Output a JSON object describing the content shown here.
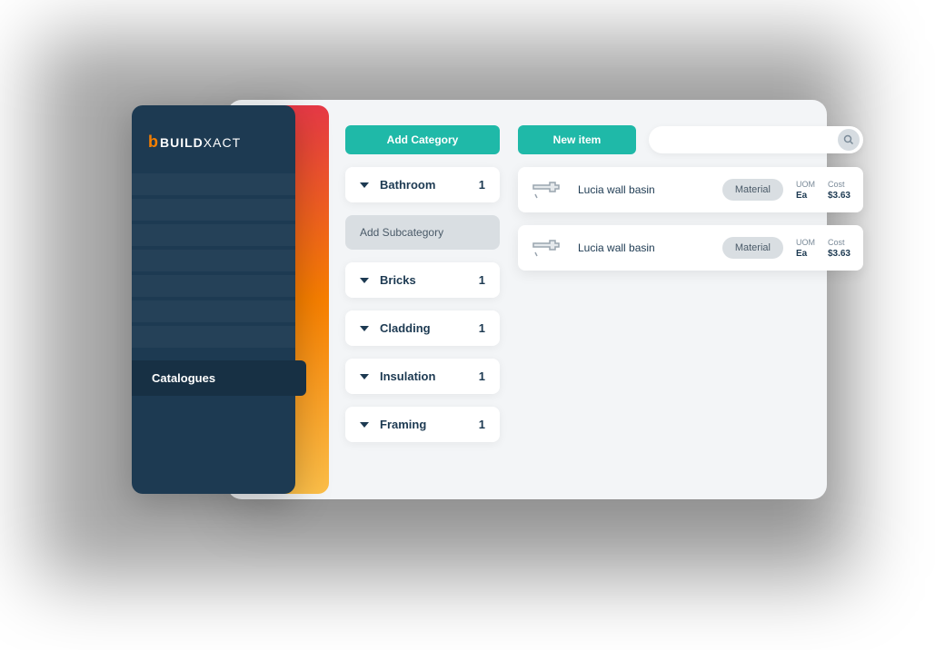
{
  "brand": {
    "icon_letter": "b",
    "name_bold": "BUILD",
    "name_light": "XACT"
  },
  "sidebar": {
    "active_label": "Catalogues"
  },
  "buttons": {
    "add_category": "Add Category",
    "new_item": "New item",
    "add_subcategory": "Add Subcategory"
  },
  "categories": [
    {
      "label": "Bathroom",
      "count": "1"
    },
    {
      "label": "Bricks",
      "count": "1"
    },
    {
      "label": "Cladding",
      "count": "1"
    },
    {
      "label": "Insulation",
      "count": "1"
    },
    {
      "label": "Framing",
      "count": "1"
    }
  ],
  "items": [
    {
      "name": "Lucia wall basin",
      "tag": "Material",
      "uom_label": "UOM",
      "uom_value": "Ea",
      "cost_label": "Cost",
      "cost_value": "$3.63"
    },
    {
      "name": "Lucia wall basin",
      "tag": "Material",
      "uom_label": "UOM",
      "uom_value": "Ea",
      "cost_label": "Cost",
      "cost_value": "$3.63"
    }
  ],
  "colors": {
    "teal": "#1fb9a8",
    "navy": "#1d3a52",
    "accent_top": "#e63946",
    "accent_bottom": "#fcbf49"
  }
}
